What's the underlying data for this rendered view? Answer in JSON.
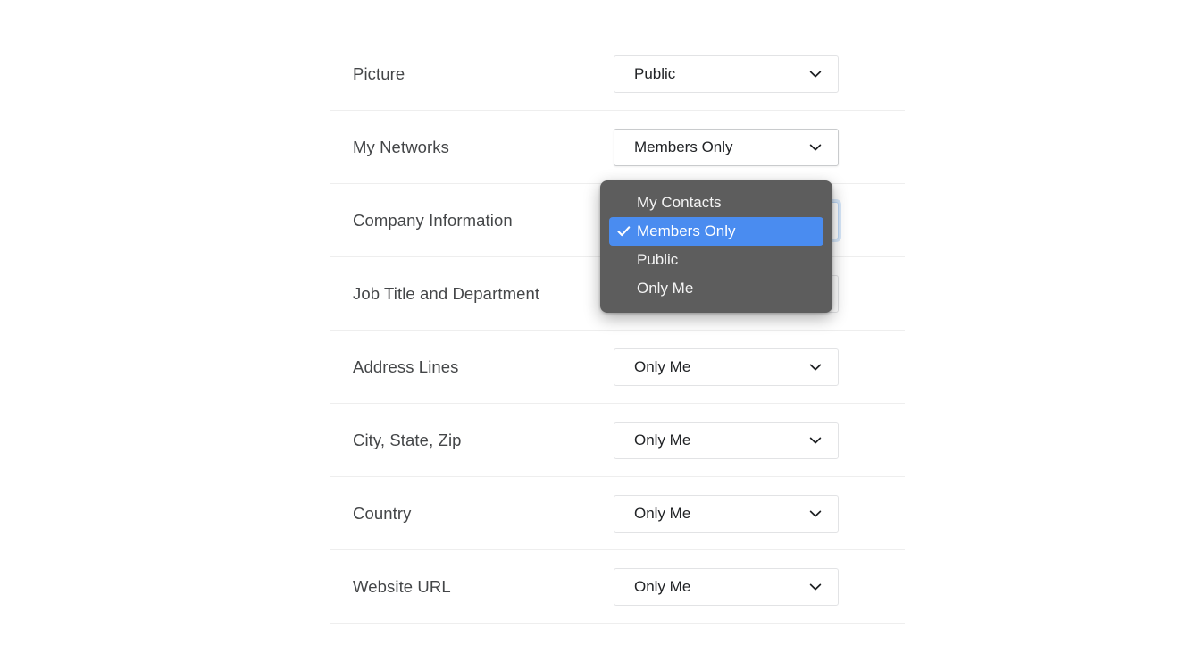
{
  "settings": {
    "rows": [
      {
        "label": "Picture",
        "value": "Public",
        "state": "normal"
      },
      {
        "label": "My Networks",
        "value": "Members Only",
        "state": "active"
      },
      {
        "label": "Company Information",
        "value": "",
        "state": "focused"
      },
      {
        "label": "Job Title and Department",
        "value": "",
        "state": "normal"
      },
      {
        "label": "Address Lines",
        "value": "Only Me",
        "state": "normal"
      },
      {
        "label": "City, State, Zip",
        "value": "Only Me",
        "state": "normal"
      },
      {
        "label": "Country",
        "value": "Only Me",
        "state": "normal"
      },
      {
        "label": "Website URL",
        "value": "Only Me",
        "state": "normal"
      }
    ]
  },
  "dropdown": {
    "owner_row_label": "My Networks",
    "selected_value": "Members Only",
    "items": [
      {
        "label": "My Contacts",
        "selected": false
      },
      {
        "label": "Members Only",
        "selected": true
      },
      {
        "label": "Public",
        "selected": false
      },
      {
        "label": "Only Me",
        "selected": false
      }
    ],
    "highlight_color": "#4a8cf0",
    "surface_color": "#5d5d5d",
    "check_icon": "checkmark-icon"
  },
  "icons": {
    "chevron": "chevron-down-icon"
  }
}
